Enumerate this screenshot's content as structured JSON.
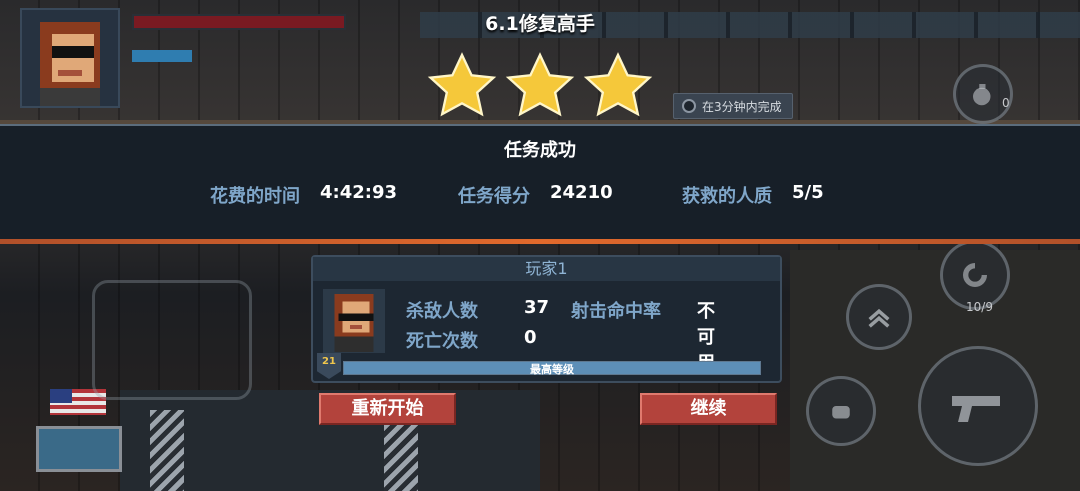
{
  "level": {
    "title": "6.1修复高手",
    "stars_earned": 3,
    "stars_total": 3
  },
  "objective": {
    "text": "在3分钟内完成",
    "icon": "clock-icon"
  },
  "result": {
    "status": "任务成功",
    "time_label": "花费的时间",
    "time_value": "4:42:93",
    "score_label": "任务得分",
    "score_value": "24210",
    "hostages_label": "获救的人质",
    "hostages_value": "5/5"
  },
  "player": {
    "name": "玩家1",
    "kills_label": "杀敌人数",
    "kills_value": "37",
    "accuracy_label": "射击命中率",
    "accuracy_value": "不可用",
    "deaths_label": "死亡次数",
    "deaths_value": "0",
    "level": "21",
    "xp_label": "最高等级",
    "xp_fraction": 1.0
  },
  "buttons": {
    "restart": "重新开始",
    "continue": "继续"
  },
  "hud": {
    "count_top_right": "0",
    "count_right": "10/9"
  },
  "colors": {
    "accent_orange": "#e26a2c",
    "label_blue": "#7fa6c9",
    "button_red": "#b3433c",
    "star_gold": "#f5c83a"
  }
}
